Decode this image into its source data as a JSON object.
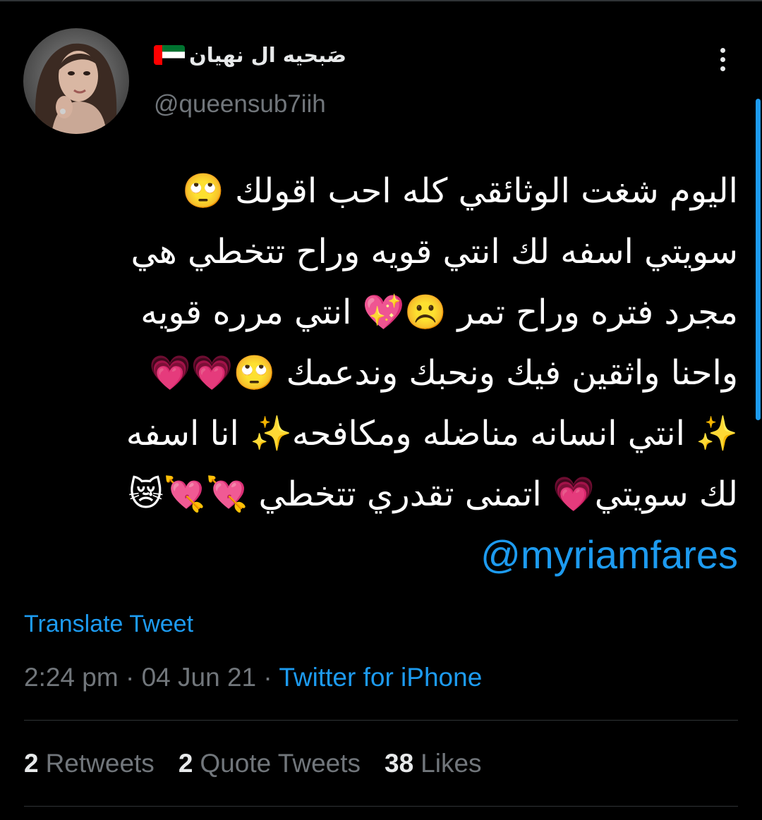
{
  "colors": {
    "background": "#000000",
    "text_primary": "#ffffff",
    "text_secondary": "#71767b",
    "link": "#1d9bf0",
    "divider": "#2f3336",
    "scroll_indicator": "#1d9bf0"
  },
  "user": {
    "display_name": "صَبحيه ال نهيان",
    "flag_icon": "uae-flag-icon",
    "handle": "@queensub7iih",
    "avatar_icon": "profile-avatar"
  },
  "menu": {
    "icon": "more-vertical-icon"
  },
  "tweet": {
    "lines": [
      "اليوم شغت الوثائقي كله احب اقولك 🙄",
      "سويتي اسفه لك انتي قويه وراح تتخطي هي",
      "مجرد فتره وراح تمر ☹️💖 انتي مرره قويه",
      "واحنا واثقين فيك ونحبك وندعمك 🙄💗💗",
      "✨ انتي انسانه مناضله ومكافحه✨ انا اسفه",
      "لك سويتي💗 اتمنى تقدري تتخطي 💘💘😿"
    ],
    "mention": "@myriamfares"
  },
  "translate_label": "Translate Tweet",
  "meta": {
    "time": "2:24 pm",
    "separator": "·",
    "date": "04 Jun 21",
    "separator2": "·",
    "source": "Twitter for iPhone"
  },
  "stats": {
    "retweets_count": "2",
    "retweets_label": "Retweets",
    "quotes_count": "2",
    "quotes_label": "Quote Tweets",
    "likes_count": "38",
    "likes_label": "Likes"
  }
}
